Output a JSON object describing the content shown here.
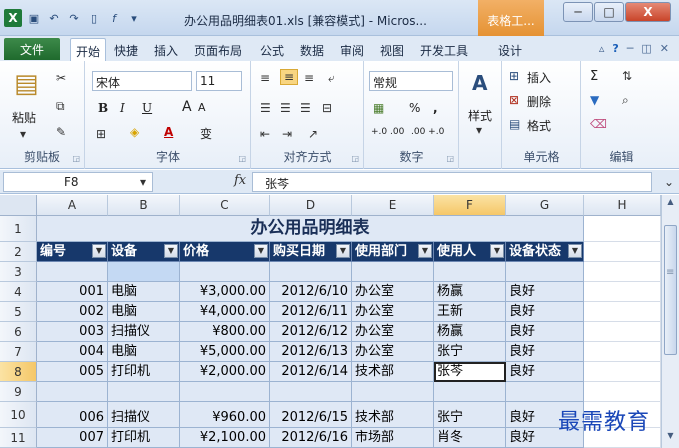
{
  "window": {
    "title": "办公用品明细表01.xls [兼容模式] - Micros...",
    "context_tab": "表格工...",
    "min": "─",
    "max": "□",
    "close": "X"
  },
  "ribbon_tabs": {
    "file": "文件",
    "tabs": [
      "开始",
      "快捷",
      "插入",
      "页面布局",
      "公式",
      "数据",
      "审阅",
      "视图",
      "开发工具",
      "设计"
    ]
  },
  "ribbon": {
    "clipboard": {
      "label": "剪贴板",
      "paste": "粘贴"
    },
    "font": {
      "label": "字体",
      "name": "宋体",
      "size": "11",
      "bold": "B",
      "italic": "I",
      "underline": "U",
      "grow": "A",
      "shrink": "A",
      "wen": "变"
    },
    "align": {
      "label": "对齐方式"
    },
    "number": {
      "label": "数字",
      "format": "常规",
      "percent": "%",
      "comma": ",",
      "inc": "+.0 .00",
      "dec": ".00 +.0"
    },
    "styles": {
      "label": "样式"
    },
    "cells": {
      "label": "单元格",
      "insert": "插入",
      "delete": "删除",
      "format": "格式"
    },
    "editing": {
      "label": "编辑",
      "sum": "Σ"
    }
  },
  "formula_bar": {
    "name_box": "F8",
    "fx": "fx",
    "value": "张芩"
  },
  "columns": [
    "A",
    "B",
    "C",
    "D",
    "E",
    "F",
    "G",
    "H"
  ],
  "rows": [
    "1",
    "2",
    "3",
    "4",
    "5",
    "6",
    "7",
    "8",
    "9",
    "10",
    "11"
  ],
  "sheet": {
    "title": "办公用品明细表",
    "headers": [
      "编号",
      "设备",
      "价格",
      "购买日期",
      "使用部门",
      "使用人",
      "设备状态"
    ],
    "data": [
      [
        "001",
        "电脑",
        "¥3,000.00",
        "2012/6/10",
        "办公室",
        "杨赢",
        "良好"
      ],
      [
        "002",
        "电脑",
        "¥4,000.00",
        "2012/6/11",
        "办公室",
        "王新",
        "良好"
      ],
      [
        "003",
        "扫描仪",
        "¥800.00",
        "2012/6/12",
        "办公室",
        "杨赢",
        "良好"
      ],
      [
        "004",
        "电脑",
        "¥5,000.00",
        "2012/6/13",
        "办公室",
        "张宁",
        "良好"
      ],
      [
        "005",
        "打印机",
        "¥2,000.00",
        "2012/6/14",
        "技术部",
        "张芩",
        "良好"
      ],
      [
        "006",
        "扫描仪",
        "¥960.00",
        "2012/6/15",
        "技术部",
        "张宁",
        "良好"
      ],
      [
        "007",
        "打印机",
        "¥2,100.00",
        "2012/6/16",
        "市场部",
        "肖冬",
        "良好"
      ]
    ]
  },
  "watermark": "最需教育"
}
